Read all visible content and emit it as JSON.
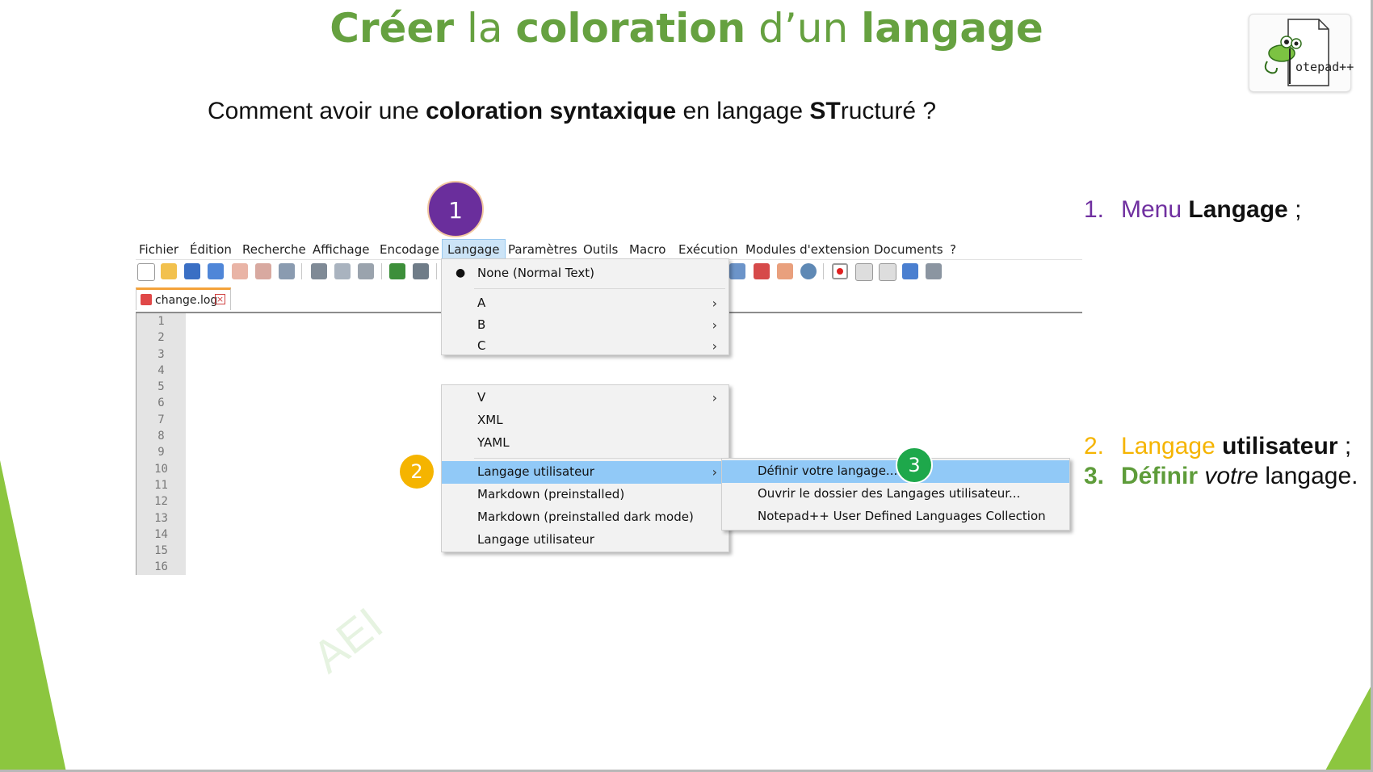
{
  "slide": {
    "title_parts": [
      "Créer",
      " la ",
      "coloration",
      " d’un ",
      "langage"
    ],
    "question_parts": [
      "Comment avoir une ",
      "coloration syntaxique",
      " en langage ",
      "ST",
      "ructuré ?"
    ],
    "watermark": "AEI",
    "logo_text": "otepad++",
    "colors": {
      "title_green": "#66a140",
      "purple": "#7030a0",
      "orange": "#f5b400",
      "green_step": "#5e9c3a",
      "badge_green": "#1ea84b",
      "triangle_green": "#8cc63f"
    }
  },
  "steps": [
    {
      "num": "1.",
      "text_a": "Menu ",
      "text_b": "Langage",
      "text_c": " ;"
    },
    {
      "num": "2.",
      "text_a": "Langage",
      "text_b": " utilisateur",
      "text_c": " ;"
    },
    {
      "num": "3.",
      "text_a": "Définir",
      "text_b": " votre",
      "text_c": " langage."
    }
  ],
  "badges": [
    "1",
    "2",
    "3"
  ],
  "app": {
    "menubar": [
      "Fichier",
      "Édition",
      "Recherche",
      "Affichage",
      "Encodage",
      "Langage",
      "Paramètres",
      "Outils",
      "Macro",
      "Exécution",
      "Modules d'extension",
      "Documents",
      "?"
    ],
    "active_menu": "Langage",
    "tab_label": "change.log",
    "line_numbers": [
      "1",
      "2",
      "3",
      "4",
      "5",
      "6",
      "7",
      "8",
      "9",
      "10",
      "11",
      "12",
      "13",
      "14",
      "15",
      "16"
    ]
  },
  "language_menu": {
    "selected": "None (Normal Text)",
    "items_top": [
      "A",
      "B",
      "C"
    ],
    "items_bottom": [
      "V",
      "XML",
      "YAML"
    ],
    "highlighted": "Langage utilisateur",
    "items_after": [
      "Markdown (preinstalled)",
      "Markdown (preinstalled dark mode)",
      "Langage utilisateur"
    ],
    "submenu_arrow": "›"
  },
  "user_lang_submenu": {
    "items": [
      "Définir votre langage...",
      "Ouvrir le dossier des Langages utilisateur...",
      "Notepad++ User Defined Languages Collection"
    ]
  }
}
